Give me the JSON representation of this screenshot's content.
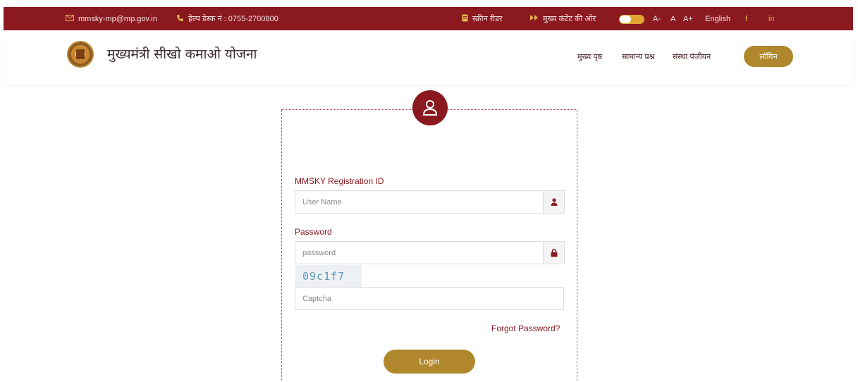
{
  "topbar": {
    "email": "mmsky-mp@mp.gov.in",
    "helpdesk": "हेल्प डेस्क नं : 0755-2700800",
    "screen_reader": "स्क्रीन रीडर",
    "skip_to_main": "मुख्य कंटेंट की ओर",
    "font_decrease": "A-",
    "font_normal": "A",
    "font_increase": "A+",
    "language": "English",
    "facebook": "f",
    "linkedin": "in",
    "accent_color": "#8a1a20"
  },
  "header": {
    "site_title": "मुख्यमंत्री सीखो कमाओ योजना",
    "nav": [
      "मुख्य पृष्ठ",
      "सामान्य प्रश्न",
      "संस्था पंजीयन"
    ],
    "login_label": "लॉगिन",
    "button_color": "#b0872c"
  },
  "login": {
    "registration_label": "MMSKY Registration ID",
    "username_placeholder": "User Name",
    "password_label": "Password",
    "password_placeholder": "password",
    "captcha_text": "09c1f7",
    "captcha_placeholder": "Captcha",
    "forgot_password": "Forgot Password?",
    "login_button": "Login"
  }
}
